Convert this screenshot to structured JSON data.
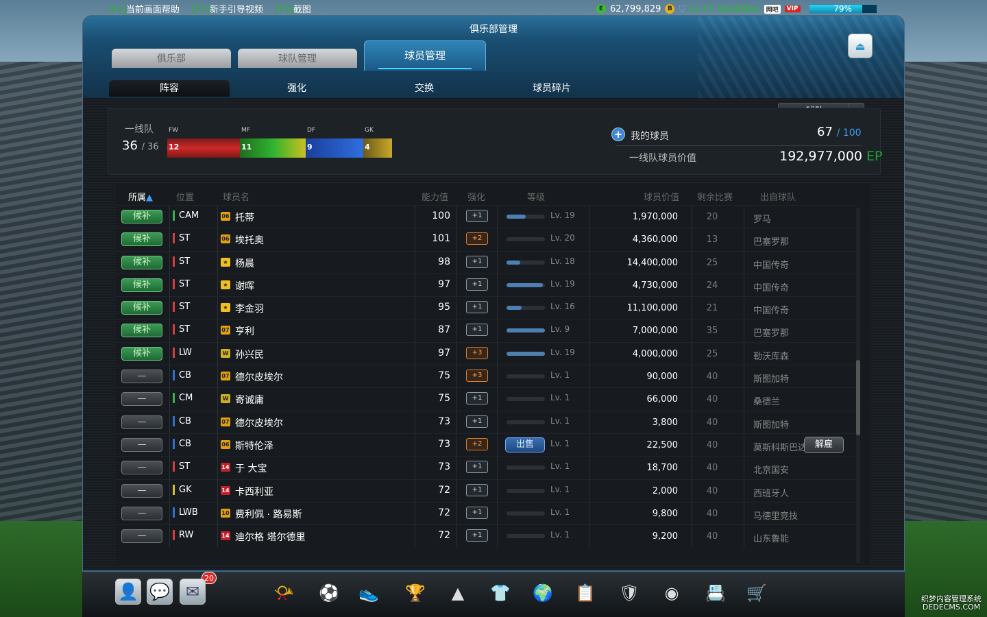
{
  "topbar": {
    "help_key": "[F1]",
    "help_label": "当前画面帮助",
    "guide_key": "[F2]",
    "guide_label": "新手引导视频",
    "shot_key": "[F3]",
    "shot_label": "截图",
    "ep_coin": "E",
    "money": "62,799,829",
    "b_coin": "B",
    "user_level": "Lv.71",
    "user_name": "DeukWoo",
    "badge1": "网吧",
    "badge2": "VIP",
    "progress_label": "79%",
    "progress_value": 79
  },
  "window": {
    "title": "俱乐部管理",
    "tabs": [
      "俱乐部",
      "球队管理",
      "球员管理"
    ],
    "active_tab": 2,
    "subtabs": [
      "阵容",
      "强化",
      "交换",
      "球员碎片"
    ],
    "active_subtab": 0,
    "team_select": "球队"
  },
  "summary": {
    "first_team_label": "一线队",
    "first_team_count": "36",
    "first_team_max": "/ 36",
    "positions": [
      {
        "label": "FW",
        "count": "12"
      },
      {
        "label": "MF",
        "count": "11"
      },
      {
        "label": "DF",
        "count": "9"
      },
      {
        "label": "GK",
        "count": "4"
      }
    ],
    "my_players_label": "我的球员",
    "my_players_count": "67",
    "my_players_max": "/ 100",
    "team_value_label": "一线队球员价值",
    "team_value": "192,977,000",
    "team_value_unit": "EP"
  },
  "table": {
    "headers": {
      "owner": "所属",
      "sort_arrow": "▲",
      "position": "位置",
      "name": "球员名",
      "ovr": "能力值",
      "enhance": "强化",
      "level": "等级",
      "value": "球员价值",
      "remaining": "剩余比赛",
      "club": "出自球队"
    },
    "sell_label": "出售",
    "release_label": "解雇",
    "rows": [
      {
        "tag": "候补",
        "pos": "CAM",
        "posColor": "#39b54a",
        "season": "06",
        "seasonColor": "#e0a010",
        "name": "托蒂",
        "ovr": "100",
        "enh": "+1",
        "xp": 0.5,
        "lv": "Lv. 19",
        "price": "1,970,000",
        "remain": "20",
        "club": "罗马"
      },
      {
        "tag": "候补",
        "pos": "ST",
        "posColor": "#e03a3a",
        "season": "06",
        "seasonColor": "#e0a010",
        "name": "埃托奥",
        "ovr": "101",
        "enh": "+2",
        "xp": 0,
        "lv": "Lv. 20",
        "price": "4,360,000",
        "remain": "13",
        "club": "巴塞罗那"
      },
      {
        "tag": "候补",
        "pos": "ST",
        "posColor": "#e03a3a",
        "season": "★",
        "seasonColor": "#f0c020",
        "name": "杨晨",
        "ovr": "98",
        "enh": "+1",
        "xp": 0.35,
        "lv": "Lv. 18",
        "price": "14,400,000",
        "remain": "25",
        "club": "中国传奇"
      },
      {
        "tag": "候补",
        "pos": "ST",
        "posColor": "#e03a3a",
        "season": "★",
        "seasonColor": "#f0c020",
        "name": "谢晖",
        "ovr": "97",
        "enh": "+1",
        "xp": 0.95,
        "lv": "Lv. 19",
        "price": "4,730,000",
        "remain": "24",
        "club": "中国传奇"
      },
      {
        "tag": "候补",
        "pos": "ST",
        "posColor": "#e03a3a",
        "season": "★",
        "seasonColor": "#f0c020",
        "name": "李金羽",
        "ovr": "95",
        "enh": "+1",
        "xp": 0.4,
        "lv": "Lv. 16",
        "price": "11,100,000",
        "remain": "21",
        "club": "中国传奇"
      },
      {
        "tag": "候补",
        "pos": "ST",
        "posColor": "#e03a3a",
        "season": "07",
        "seasonColor": "#e0a010",
        "name": "亨利",
        "ovr": "87",
        "enh": "+1",
        "xp": 1,
        "lv": "Lv. 9",
        "price": "7,000,000",
        "remain": "35",
        "club": "巴塞罗那"
      },
      {
        "tag": "候补",
        "pos": "LW",
        "posColor": "#e03a3a",
        "season": "W",
        "seasonColor": "#d0b020",
        "name": "孙兴民",
        "ovr": "97",
        "enh": "+3",
        "xp": 1,
        "lv": "Lv. 19",
        "price": "4,000,000",
        "remain": "25",
        "club": "勒沃库森"
      },
      {
        "tag": "—",
        "pos": "CB",
        "posColor": "#2e6fe0",
        "season": "07",
        "seasonColor": "#e0a010",
        "name": "德尔皮埃尔",
        "ovr": "75",
        "enh": "+3",
        "xp": 0,
        "lv": "Lv. 1",
        "price": "90,000",
        "remain": "40",
        "club": "斯图加特"
      },
      {
        "tag": "—",
        "pos": "CM",
        "posColor": "#39b54a",
        "season": "W",
        "seasonColor": "#d0b020",
        "name": "寄诚庸",
        "ovr": "75",
        "enh": "+1",
        "xp": 0,
        "lv": "Lv. 1",
        "price": "66,000",
        "remain": "40",
        "club": "桑德兰"
      },
      {
        "tag": "—",
        "pos": "CB",
        "posColor": "#2e6fe0",
        "season": "07",
        "seasonColor": "#e0a010",
        "name": "德尔皮埃尔",
        "ovr": "73",
        "enh": "+1",
        "xp": 0,
        "lv": "Lv. 1",
        "price": "3,800",
        "remain": "40",
        "club": "斯图加特"
      },
      {
        "tag": "—",
        "pos": "CB",
        "posColor": "#2e6fe0",
        "season": "06",
        "seasonColor": "#e0a010",
        "name": "斯特伦泽",
        "ovr": "73",
        "enh": "+2",
        "xp": 0,
        "lv": "Lv. 1",
        "price": "22,500",
        "remain": "40",
        "club": "莫斯科斯巴达",
        "selected": true
      },
      {
        "tag": "—",
        "pos": "ST",
        "posColor": "#e03a3a",
        "season": "14",
        "seasonColor": "#c0202a",
        "name": "于 大宝",
        "ovr": "73",
        "enh": "+1",
        "xp": 0,
        "lv": "Lv. 1",
        "price": "18,700",
        "remain": "40",
        "club": "北京国安"
      },
      {
        "tag": "—",
        "pos": "GK",
        "posColor": "#e0c020",
        "season": "14",
        "seasonColor": "#c0202a",
        "name": "卡西利亚",
        "ovr": "72",
        "enh": "+1",
        "xp": 0,
        "lv": "Lv. 1",
        "price": "2,000",
        "remain": "40",
        "club": "西班牙人"
      },
      {
        "tag": "—",
        "pos": "LWB",
        "posColor": "#2e6fe0",
        "season": "10",
        "seasonColor": "#e0a010",
        "name": "费利佩 · 路易斯",
        "ovr": "72",
        "enh": "+1",
        "xp": 0,
        "lv": "Lv. 1",
        "price": "9,800",
        "remain": "40",
        "club": "马德里竞技"
      },
      {
        "tag": "—",
        "pos": "RW",
        "posColor": "#e03a3a",
        "season": "14",
        "seasonColor": "#c0202a",
        "name": "迪尔格 塔尔德里",
        "ovr": "72",
        "enh": "+1",
        "xp": 0,
        "lv": "Lv. 1",
        "price": "9,200",
        "remain": "40",
        "club": "山东鲁能"
      }
    ]
  },
  "dock": {
    "mail_badge": "20",
    "icons": [
      "profile-icon",
      "chat-icon",
      "mail-icon",
      "whistle-icon",
      "ball-icon",
      "boots-icon",
      "trophy-icon",
      "ranking-icon",
      "jersey-icon",
      "globe-icon",
      "notepad-icon",
      "card-pack-icon",
      "club-icon",
      "scout-icon",
      "shop-cart-icon"
    ]
  },
  "watermark": {
    "line1": "织梦内容管理系统",
    "line2": "DEDECMS.COM"
  }
}
